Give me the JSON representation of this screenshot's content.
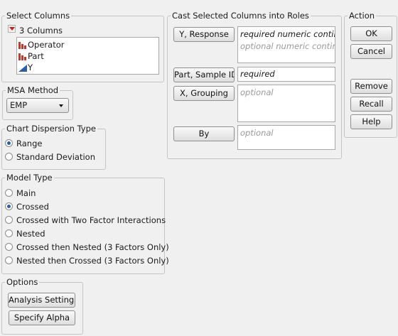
{
  "select_columns": {
    "title": "Select Columns",
    "count_label": "3 Columns",
    "columns": [
      {
        "label": "Operator",
        "icon": "nominal-bar-icon"
      },
      {
        "label": "Part",
        "icon": "nominal-bar-icon"
      },
      {
        "label": "Y",
        "icon": "continuous-triangle-icon"
      }
    ]
  },
  "msa_method": {
    "title": "MSA Method",
    "selected": "EMP"
  },
  "chart_dispersion": {
    "title": "Chart Dispersion Type",
    "options": [
      "Range",
      "Standard Deviation"
    ],
    "selected_index": 0
  },
  "model_type": {
    "title": "Model Type",
    "options": [
      "Main",
      "Crossed",
      "Crossed with Two Factor Interactions",
      "Nested",
      "Crossed then Nested (3 Factors Only)",
      "Nested then Crossed (3 Factors Only)"
    ],
    "selected_index": 1
  },
  "options": {
    "title": "Options",
    "analysis_settings_label": "Analysis Settings",
    "specify_alpha_label": "Specify Alpha"
  },
  "cast_roles": {
    "title": "Cast Selected Columns into Roles",
    "y_response": {
      "label": "Y, Response",
      "line1": "required numeric continu",
      "line2": "optional numeric continu"
    },
    "part_sample_id": {
      "label": "Part, Sample ID",
      "value": "required"
    },
    "x_grouping": {
      "label": "X, Grouping",
      "value": "optional"
    },
    "by": {
      "label": "By",
      "value": "optional"
    }
  },
  "action": {
    "title": "Action",
    "ok_label": "OK",
    "cancel_label": "Cancel",
    "remove_label": "Remove",
    "recall_label": "Recall",
    "help_label": "Help"
  },
  "colors": {
    "accent": "#2a5fb0",
    "red_triangle": "#d11f1f",
    "nominal_icon": "#c0392b"
  }
}
